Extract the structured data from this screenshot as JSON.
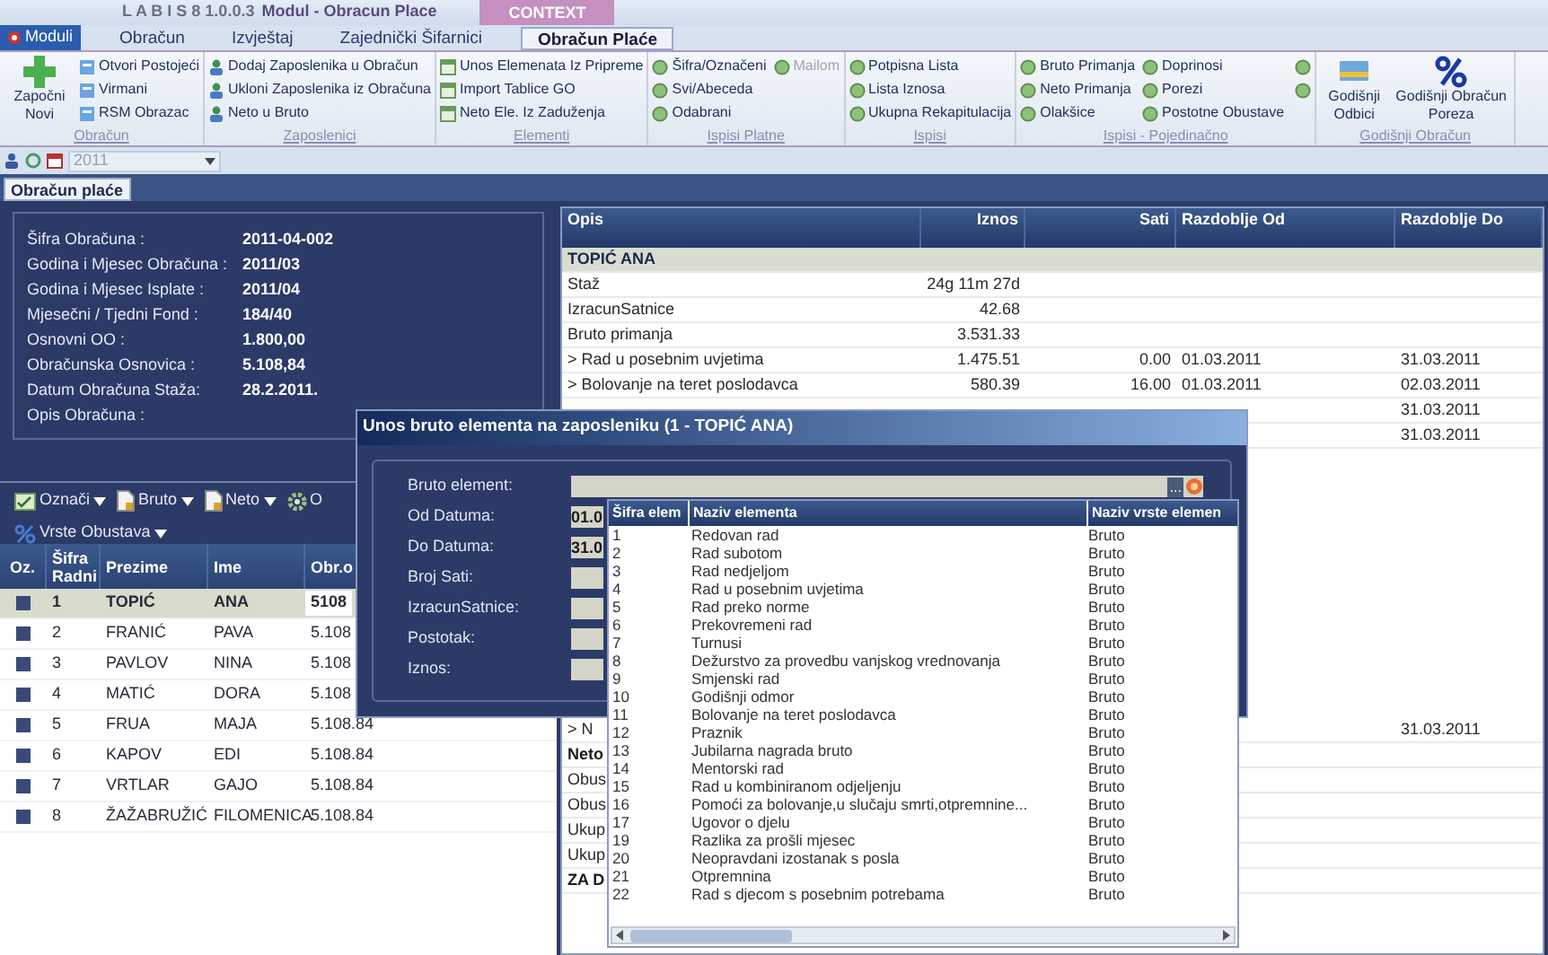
{
  "title_bar": {
    "app": "L A B I S 8 1.0.0.3",
    "module": "Modul - Obracun Place",
    "context": "CONTEXT"
  },
  "app_menu": "Moduli",
  "menu_tabs": [
    {
      "label": "Obračun",
      "selected": false
    },
    {
      "label": "Izvještaj",
      "selected": false
    },
    {
      "label": "Zajednički Šifarnici",
      "selected": false
    },
    {
      "label": "Obračun Plaće",
      "selected": true
    }
  ],
  "ribbon": [
    {
      "label": "Obračun",
      "items": [
        {
          "label": "Započni Novi",
          "kind": "large"
        },
        {
          "label": "Otvori Postojeći",
          "kind": "small"
        },
        {
          "label": "Virmani",
          "kind": "small"
        },
        {
          "label": "RSM Obrazac",
          "kind": "small"
        }
      ]
    },
    {
      "label": "Zaposlenici",
      "items": [
        {
          "label": "Dodaj Zaposlenika u Obračun",
          "kind": "small"
        },
        {
          "label": "Ukloni Zaposlenika iz Obračuna",
          "kind": "small"
        },
        {
          "label": "Neto u Bruto",
          "kind": "small"
        }
      ]
    },
    {
      "label": "Elementi",
      "items": [
        {
          "label": "Unos Elemenata Iz Pripreme",
          "kind": "small"
        },
        {
          "label": "Import Tablice GO",
          "kind": "small"
        },
        {
          "label": "Neto Ele. Iz Zaduženja",
          "kind": "small"
        }
      ]
    },
    {
      "label": "Ispisi Platne",
      "items": [
        {
          "label": "Šifra/Označeni",
          "kind": "small",
          "disabled": false
        },
        {
          "label": "Svi/Abeceda",
          "kind": "small",
          "disabled": false
        },
        {
          "label": "Odabrani",
          "kind": "small",
          "disabled": false
        },
        {
          "label": "Mailom",
          "kind": "small",
          "disabled": true
        }
      ]
    },
    {
      "label": "Ispisi",
      "items": [
        {
          "label": "Potpisna Lista",
          "kind": "small"
        },
        {
          "label": "Lista Iznosa",
          "kind": "small"
        },
        {
          "label": "Ukupna Rekapitulacija",
          "kind": "small"
        }
      ]
    },
    {
      "label": "Ispisi - Pojedinačno",
      "items": [
        {
          "label": "Bruto Primanja",
          "kind": "small"
        },
        {
          "label": "Neto Primanja",
          "kind": "small"
        },
        {
          "label": "Olakšice",
          "kind": "small"
        },
        {
          "label": "Doprinosi",
          "kind": "small"
        },
        {
          "label": "Porezi",
          "kind": "small"
        },
        {
          "label": "Postotne Obustave",
          "kind": "small"
        },
        {
          "kind": "icon"
        },
        {
          "kind": "icon"
        }
      ]
    },
    {
      "label": "Godišnji Obračun",
      "items": [
        {
          "label": "Godišnji Odbici",
          "kind": "large"
        },
        {
          "label": "Godišnji Obračun Poreza",
          "kind": "large"
        }
      ]
    }
  ],
  "quick_toolbar": {
    "year": "2011"
  },
  "document_tabs": [
    {
      "label": "Obračun plaće",
      "selected": true
    }
  ],
  "info": [
    {
      "label": "Šifra Obračuna :",
      "value": "2011-04-002"
    },
    {
      "label": "Godina i Mjesec Obračuna :",
      "value": "2011/03"
    },
    {
      "label": "Godina i Mjesec Isplate :",
      "value": "2011/04"
    },
    {
      "label": "Mjesečni / Tjedni Fond :",
      "value": "184/40"
    },
    {
      "label": "Osnovni OO :",
      "value": "1.800,00"
    },
    {
      "label": "Obračunska Osnovica :",
      "value": "5.108,84"
    },
    {
      "label": "Datum Obračuna Staža:",
      "value": "28.2.2011."
    },
    {
      "label": "Opis Obračuna :"
    }
  ],
  "employee_toolbar": [
    {
      "label": "Označi",
      "menu": true
    },
    {
      "label": "Bruto",
      "menu": true
    },
    {
      "label": "Neto",
      "menu": true
    },
    {
      "label": "O",
      "menu": false
    },
    {
      "label": "Vrste Obustava",
      "menu": true
    }
  ],
  "employees": {
    "columns": [
      "Oz.",
      "Šifra Radni",
      "Prezime",
      "Ime",
      "Obr.o"
    ],
    "rows": [
      {
        "sifra": "1",
        "prezime": "TOPIĆ",
        "ime": "ANA",
        "obracun": "5108",
        "selected": true
      },
      {
        "sifra": "2",
        "prezime": "FRANIĆ",
        "ime": "PAVA",
        "obracun": "5.108",
        "selected": false
      },
      {
        "sifra": "3",
        "prezime": "PAVLOV",
        "ime": "NINA",
        "obracun": "5.108",
        "selected": false
      },
      {
        "sifra": "4",
        "prezime": "MATIĆ",
        "ime": "DORA",
        "obracun": "5.108",
        "selected": false
      },
      {
        "sifra": "5",
        "prezime": "FRUA",
        "ime": "MAJA",
        "obracun": "5.108.84",
        "selected": false
      },
      {
        "sifra": "6",
        "prezime": "KAPOV",
        "ime": "EDI",
        "obracun": "5.108.84",
        "selected": false
      },
      {
        "sifra": "7",
        "prezime": "VRTLAR",
        "ime": "GAJO",
        "obracun": "5.108.84",
        "selected": false
      },
      {
        "sifra": "8",
        "prezime": "ŽAŽABRUŽIĆ",
        "ime": "FILOMENICA",
        "obracun": "5.108.84",
        "selected": false
      }
    ]
  },
  "details": {
    "columns": [
      "Opis",
      "Iznos",
      "Sati",
      "Razdoblje Od",
      "Razdoblje Do"
    ],
    "rows": [
      {
        "kind": "group",
        "opis": "TOPIĆ ANA"
      },
      {
        "kind": "item",
        "opis": "Staž",
        "iznos": "24g 11m 27d"
      },
      {
        "kind": "item",
        "opis": "IzracunSatnice",
        "iznos": "42.68"
      },
      {
        "kind": "item",
        "opis": "Bruto primanja",
        "iznos": "3.531.33"
      },
      {
        "kind": "item",
        "opis": "> Rad u posebnim uvjetima",
        "iznos": "1.475.51",
        "sati": "0.00",
        "od": "01.03.2011",
        "do": "31.03.2011"
      },
      {
        "kind": "item",
        "opis": "> Bolovanje na teret poslodavca",
        "iznos": "580.39",
        "sati": "16.00",
        "od": "01.03.2011",
        "do": "02.03.2011"
      },
      {
        "kind": "item",
        "do": "31.03.2011"
      },
      {
        "kind": "item",
        "do": "31.03.2011"
      }
    ],
    "rows_lower": [
      {
        "kind": "item",
        "opis": "> N",
        "do": "31.03.2011"
      },
      {
        "kind": "total",
        "opis": "Neto"
      },
      {
        "kind": "item",
        "opis": "Obus"
      },
      {
        "kind": "item",
        "opis": "Obus"
      },
      {
        "kind": "item",
        "opis": "Ukup"
      },
      {
        "kind": "item",
        "opis": "Ukup"
      },
      {
        "kind": "total",
        "opis": "ZA D"
      }
    ]
  },
  "dialog": {
    "title": "Unos bruto elementa na zaposleniku (1 - TOPIĆ ANA)",
    "fields": [
      {
        "label": "Bruto element:",
        "kind": "lookup",
        "browse": "..."
      },
      {
        "label": "Od Datuma:",
        "kind": "text",
        "value": "01.0"
      },
      {
        "label": "Do Datuma:",
        "kind": "text",
        "value": "31.0"
      },
      {
        "label": "Broj Sati:",
        "kind": "text"
      },
      {
        "label": "IzracunSatnice:",
        "kind": "text"
      },
      {
        "label": "Postotak:",
        "kind": "text"
      },
      {
        "label": "Iznos:",
        "kind": "text"
      }
    ]
  },
  "lookup_list": {
    "columns": [
      "Šifra elem",
      "Naziv elementa",
      "Naziv vrste elemen"
    ],
    "rows": [
      {
        "code": "1",
        "name": "Redovan rad",
        "type": "Bruto"
      },
      {
        "code": "2",
        "name": "Rad subotom",
        "type": "Bruto"
      },
      {
        "code": "3",
        "name": "Rad nedjeljom",
        "type": "Bruto"
      },
      {
        "code": "4",
        "name": "Rad u posebnim uvjetima",
        "type": "Bruto"
      },
      {
        "code": "5",
        "name": "Rad preko norme",
        "type": "Bruto"
      },
      {
        "code": "6",
        "name": "Prekovremeni rad",
        "type": "Bruto"
      },
      {
        "code": "7",
        "name": "Turnusi",
        "type": "Bruto"
      },
      {
        "code": "8",
        "name": "Dežurstvo za provedbu vanjskog vrednovanja",
        "type": "Bruto"
      },
      {
        "code": "9",
        "name": "Smjenski rad",
        "type": "Bruto"
      },
      {
        "code": "10",
        "name": "Godišnji odmor",
        "type": "Bruto"
      },
      {
        "code": "11",
        "name": "Bolovanje na teret poslodavca",
        "type": "Bruto"
      },
      {
        "code": "12",
        "name": "Praznik",
        "type": "Bruto"
      },
      {
        "code": "13",
        "name": "Jubilarna nagrada bruto",
        "type": "Bruto"
      },
      {
        "code": "14",
        "name": "Mentorski rad",
        "type": "Bruto"
      },
      {
        "code": "15",
        "name": "Rad u kombiniranom odjeljenju",
        "type": "Bruto"
      },
      {
        "code": "16",
        "name": "Pomoći za bolovanje,u slučaju smrti,otpremnine...",
        "type": "Bruto"
      },
      {
        "code": "17",
        "name": "Ugovor o djelu",
        "type": "Bruto"
      },
      {
        "code": "19",
        "name": "Razlika za prošli mjesec",
        "type": "Bruto"
      },
      {
        "code": "20",
        "name": "Neopravdani izostanak s posla",
        "type": "Bruto"
      },
      {
        "code": "21",
        "name": "Otpremnina",
        "type": "Bruto"
      },
      {
        "code": "22",
        "name": "Rad s djecom s posebnim potrebama",
        "type": "Bruto"
      }
    ]
  }
}
